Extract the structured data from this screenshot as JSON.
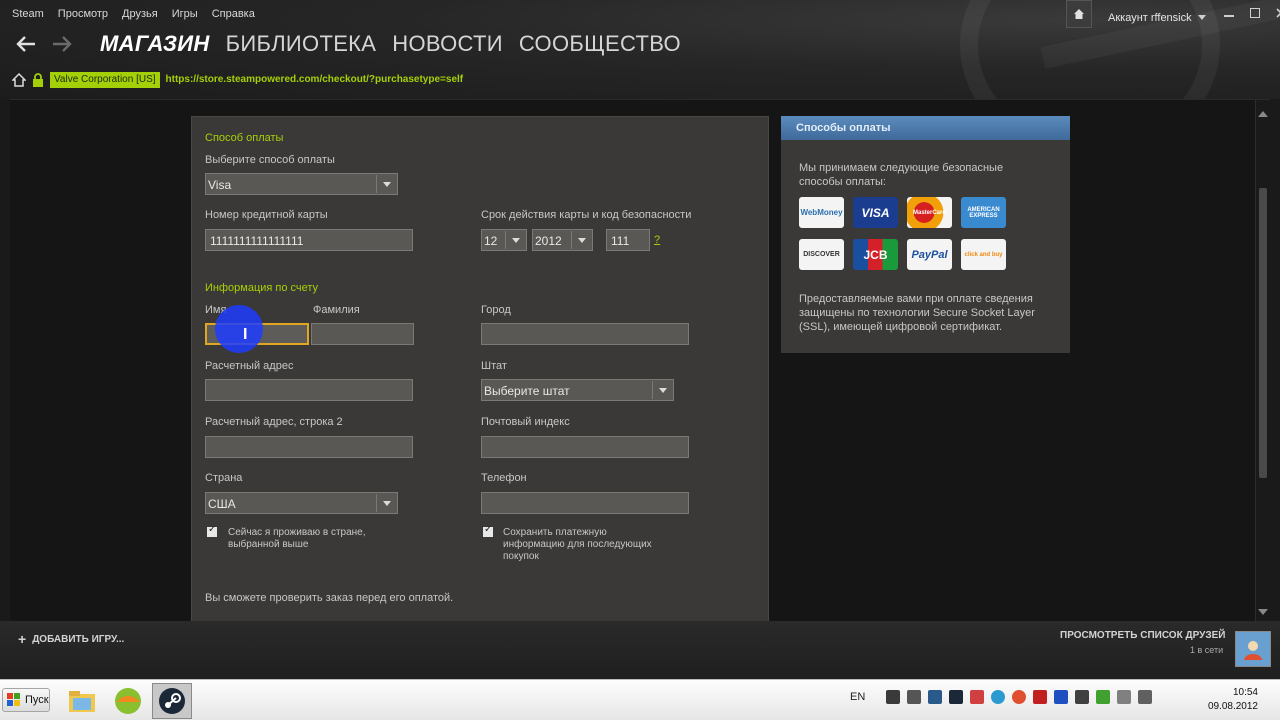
{
  "menubar": {
    "items": [
      "Steam",
      "Просмотр",
      "Друзья",
      "Игры",
      "Справка"
    ]
  },
  "account": {
    "label": "Аккаунт rffensick"
  },
  "nav": {
    "store": "МАГАЗИН",
    "library": "БИБЛИОТЕКА",
    "news": "НОВОСТИ",
    "community": "СООБЩЕСТВО"
  },
  "urlbar": {
    "cert": "Valve Corporation [US]",
    "url": "https://store.steampowered.com/checkout/?purchasetype=self"
  },
  "form": {
    "payment_section": "Способ оплаты",
    "choose_method_label": "Выберите способ оплаты",
    "method_value": "Visa",
    "card_number_label": "Номер кредитной карты",
    "card_number_value": "1111111111111111",
    "expiry_label": "Срок действия карты и код безопасности",
    "expiry_month": "12",
    "expiry_year": "2012",
    "cvv_value": "111",
    "cvv_help": "?",
    "billing_section": "Информация по счету",
    "first_name_label": "Имя",
    "last_name_label": "Фамилия",
    "city_label": "Город",
    "address_label": "Расчетный адрес",
    "state_label": "Штат",
    "state_value": "Выберите штат",
    "address2_label": "Расчетный адрес, строка 2",
    "zip_label": "Почтовый индекс",
    "country_label": "Страна",
    "country_value": "США",
    "phone_label": "Телефон",
    "reside_check_line1": "Сейчас я проживаю в стране,",
    "reside_check_line2": "выбранной выше",
    "save_check_line1": "Сохранить платежную",
    "save_check_line2": "информацию для последующих",
    "save_check_line3": "покупок",
    "review_note": "Вы сможете проверить заказ перед его оплатой."
  },
  "payment_panel": {
    "header": "Способы оплаты",
    "intro": "Мы принимаем следующие безопасные способы оплаты:",
    "cards": [
      "WebMoney",
      "VISA",
      "MasterCard",
      "AMERICAN EXPRESS",
      "DISCOVER",
      "JCB",
      "PayPal",
      "click and buy"
    ],
    "ssl_note": "Предоставляемые вами при оплате сведения защищены по технологии Secure Socket Layer (SSL), имеющей цифровой сертификат."
  },
  "bottombar": {
    "add_game": "ДОБАВИТЬ ИГРУ...",
    "friends": "ПРОСМОТРЕТЬ СПИСОК ДРУЗЕЙ",
    "online": "1 в сети"
  },
  "taskbar": {
    "start": "Пуск",
    "lang": "EN",
    "time": "10:54",
    "date": "09.08.2012"
  },
  "colors": {
    "accent_green": "#a4d007",
    "panel_bg": "#3b3937",
    "header_blue": "#4a7aab"
  }
}
